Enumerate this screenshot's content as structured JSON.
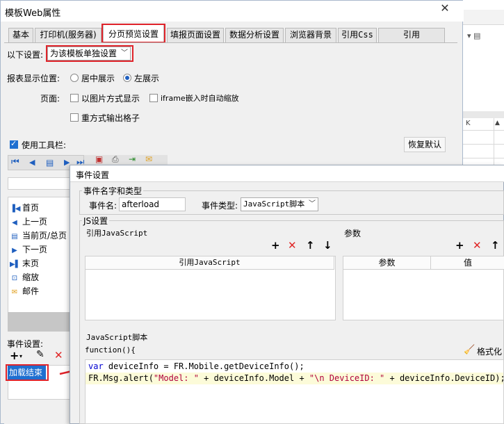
{
  "window": {
    "title": "模板Web属性",
    "close": "✕"
  },
  "tabs": [
    {
      "label": "基本"
    },
    {
      "label": "打印机(服务器)"
    },
    {
      "label": "分页预览设置"
    },
    {
      "label": "填报页面设置"
    },
    {
      "label": "数据分析设置"
    },
    {
      "label": "浏览器背景"
    },
    {
      "label": "引用Css"
    },
    {
      "label": "引用JavaScript"
    }
  ],
  "settings": {
    "scope_label": "以下设置:",
    "scope_value": "为该模板单独设置",
    "position_label": "报表显示位置:",
    "center_label": "居中展示",
    "left_label": "左展示",
    "page_label": "页面:",
    "image_mode_label": "以图片方式显示",
    "iframe_label": "iframe嵌入时自动缩放",
    "output_grid_label": "重方式输出格子",
    "toolbar_label": "使用工具栏:",
    "restore_default": "恢复默认",
    "event_settings_label": "事件设置:",
    "event_item": "加载结束"
  },
  "toolbar_list": [
    {
      "label": "首页",
      "icon": "first-page-icon",
      "glyph": "▐◀"
    },
    {
      "label": "上一页",
      "icon": "prev-page-icon",
      "glyph": "◀"
    },
    {
      "label": "当前页/总页",
      "icon": "page-count-icon",
      "glyph": "▤"
    },
    {
      "label": "下一页",
      "icon": "next-page-icon",
      "glyph": "▶"
    },
    {
      "label": "末页",
      "icon": "last-page-icon",
      "glyph": "▶▌"
    },
    {
      "label": "缩放",
      "icon": "zoom-icon",
      "glyph": "⊡"
    },
    {
      "label": "邮件",
      "icon": "mail-icon",
      "glyph": "✉"
    }
  ],
  "dialog": {
    "title": "事件设置",
    "group_name_type": "事件名字和类型",
    "event_name_label": "事件名:",
    "event_name_value": "afterload",
    "event_type_label": "事件类型:",
    "event_type_value": "JavaScript脚本",
    "js_group": "JS设置",
    "ref_js_label": "引用JavaScript",
    "params_label": "参数",
    "col_ref_js": "引用JavaScript",
    "col_param": "参数",
    "col_value": "值",
    "script_label": "JavaScript脚本",
    "function_header": "function(){",
    "format_label": "格式化",
    "code_line1_kw": "var",
    "code_line1_rest": " deviceInfo = FR.Mobile.getDeviceInfo();",
    "code_line2_a": "FR.Msg.alert(",
    "code_line2_s1": "\"Model: \"",
    "code_line2_b": " + deviceInfo.Model + ",
    "code_line2_s2": "\"\\n DeviceID: \"",
    "code_line2_c": " + deviceInfo.DeviceID);"
  },
  "colors": {
    "highlight_red": "#e0232a",
    "selection_blue": "#1f6fd0",
    "keyword_blue": "#0000d0"
  }
}
